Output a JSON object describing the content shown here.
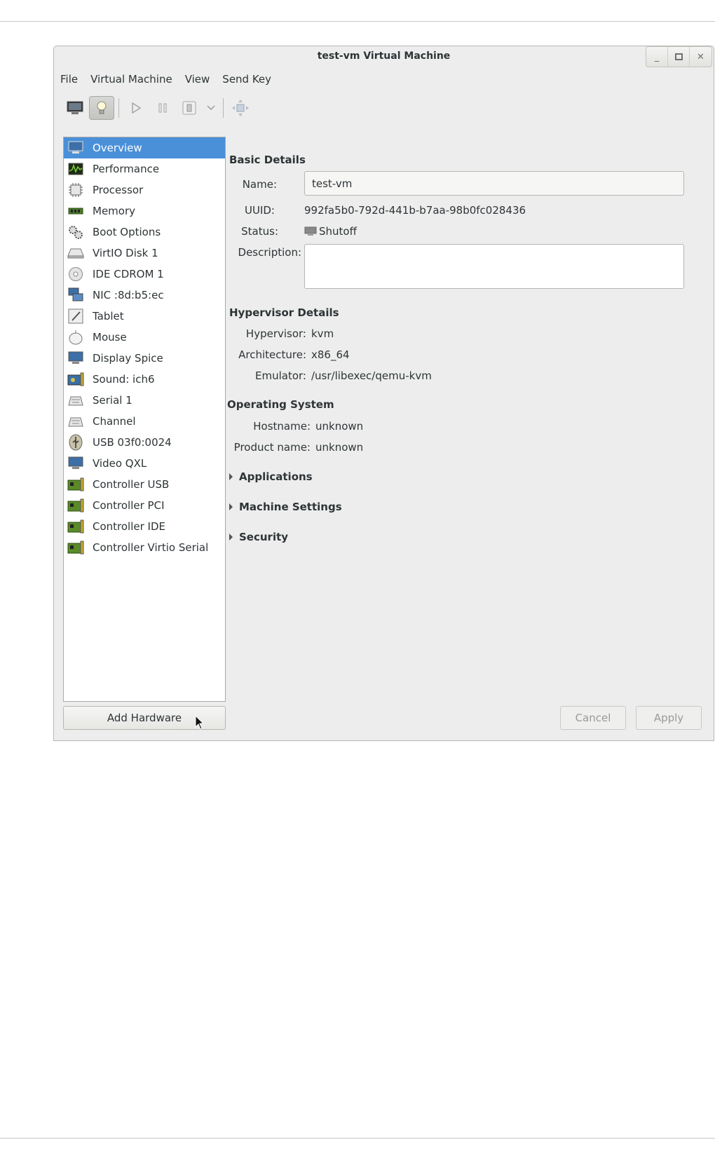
{
  "window": {
    "title": "test-vm Virtual Machine"
  },
  "menubar": [
    "File",
    "Virtual Machine",
    "View",
    "Send Key"
  ],
  "toolbar": {
    "buttons": [
      "console-monitor-icon",
      "details-bulb-icon",
      "run-play-icon",
      "pause-icon",
      "shutdown-icon",
      "dropdown-chevron-icon",
      "fullscreen-icon"
    ],
    "active": "details-bulb-icon"
  },
  "sidebar": {
    "selected": "Overview",
    "items": [
      {
        "label": "Overview",
        "icon": "monitor-icon"
      },
      {
        "label": "Performance",
        "icon": "performance-graph-icon"
      },
      {
        "label": "Processor",
        "icon": "cpu-chip-icon"
      },
      {
        "label": "Memory",
        "icon": "memory-stick-icon"
      },
      {
        "label": "Boot Options",
        "icon": "gears-icon"
      },
      {
        "label": "VirtIO Disk 1",
        "icon": "hard-disk-icon"
      },
      {
        "label": "IDE CDROM 1",
        "icon": "cdrom-icon"
      },
      {
        "label": "NIC :8d:b5:ec",
        "icon": "network-icon"
      },
      {
        "label": "Tablet",
        "icon": "tablet-icon"
      },
      {
        "label": "Mouse",
        "icon": "mouse-icon"
      },
      {
        "label": "Display Spice",
        "icon": "display-icon"
      },
      {
        "label": "Sound: ich6",
        "icon": "sound-card-icon"
      },
      {
        "label": "Serial 1",
        "icon": "serial-port-icon"
      },
      {
        "label": "Channel",
        "icon": "channel-icon"
      },
      {
        "label": "USB 03f0:0024",
        "icon": "usb-device-icon"
      },
      {
        "label": "Video QXL",
        "icon": "video-card-icon"
      },
      {
        "label": "Controller USB",
        "icon": "controller-card-icon"
      },
      {
        "label": "Controller PCI",
        "icon": "controller-card-icon"
      },
      {
        "label": "Controller IDE",
        "icon": "controller-card-icon"
      },
      {
        "label": "Controller Virtio Serial",
        "icon": "controller-card-icon"
      }
    ],
    "add_hardware": "Add Hardware"
  },
  "basic": {
    "heading": "Basic Details",
    "name_label": "Name:",
    "name_value": "test-vm",
    "uuid_label": "UUID:",
    "uuid_value": "992fa5b0-792d-441b-b7aa-98b0fc028436",
    "status_label": "Status:",
    "status_value": "Shutoff",
    "description_label": "Description:",
    "description_value": ""
  },
  "hypervisor": {
    "heading": "Hypervisor Details",
    "hypervisor_label": "Hypervisor:",
    "hypervisor_value": "kvm",
    "arch_label": "Architecture:",
    "arch_value": "x86_64",
    "emulator_label": "Emulator:",
    "emulator_value": "/usr/libexec/qemu-kvm"
  },
  "os": {
    "heading": "Operating System",
    "hostname_label": "Hostname:",
    "hostname_value": "unknown",
    "product_label": "Product name:",
    "product_value": "unknown"
  },
  "expanders": [
    "Applications",
    "Machine Settings",
    "Security"
  ],
  "footer": {
    "cancel": "Cancel",
    "apply": "Apply"
  },
  "colors": {
    "selection": "#4a90d9",
    "window_bg": "#ededed"
  }
}
